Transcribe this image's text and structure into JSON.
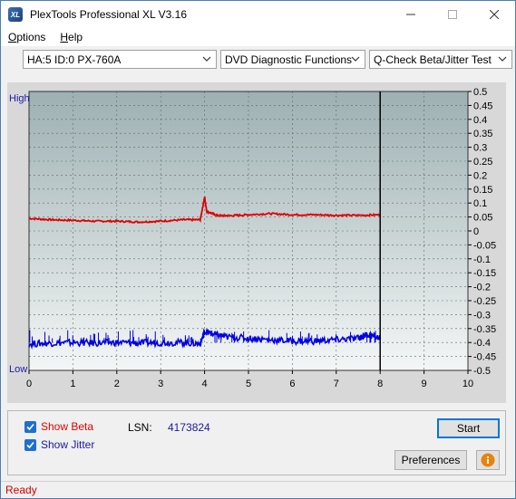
{
  "window": {
    "title": "PlexTools Professional XL V3.16",
    "icon_text": "XL"
  },
  "menu": [
    {
      "label": "Options",
      "mnemonic": "O",
      "rest": "ptions"
    },
    {
      "label": "Help",
      "mnemonic": "H",
      "rest": "elp"
    }
  ],
  "toolbar": {
    "drive": "HA:5 ID:0  PX-760A",
    "function": "DVD Diagnostic Functions",
    "test": "Q-Check Beta/Jitter Test"
  },
  "chart_data": {
    "type": "line",
    "left_axis": {
      "top_label": "High",
      "bottom_label": "Low"
    },
    "x": {
      "ticks": [
        0,
        1,
        2,
        3,
        4,
        5,
        6,
        7,
        8,
        9,
        10
      ],
      "range": [
        0,
        10
      ]
    },
    "y_right": {
      "range": [
        -0.5,
        0.5
      ],
      "ticks": [
        "0.5",
        "0.45",
        "0.4",
        "0.35",
        "0.3",
        "0.25",
        "0.2",
        "0.15",
        "0.1",
        "0.05",
        "0",
        "-0.05",
        "-0.1",
        "-0.15",
        "-0.2",
        "-0.25",
        "-0.3",
        "-0.35",
        "-0.4",
        "-0.45",
        "-0.5"
      ]
    },
    "end_marker_x": 8.0,
    "series": [
      {
        "color": "#e00000",
        "points": [
          [
            0,
            0.045
          ],
          [
            0.5,
            0.04
          ],
          [
            1,
            0.038
          ],
          [
            1.5,
            0.035
          ],
          [
            2,
            0.035
          ],
          [
            2.5,
            0.032
          ],
          [
            3,
            0.035
          ],
          [
            3.5,
            0.04
          ],
          [
            3.9,
            0.04
          ],
          [
            4.0,
            0.12
          ],
          [
            4.05,
            0.07
          ],
          [
            4.3,
            0.055
          ],
          [
            4.6,
            0.055
          ],
          [
            5,
            0.058
          ],
          [
            5.5,
            0.062
          ],
          [
            6,
            0.058
          ],
          [
            6.5,
            0.058
          ],
          [
            7,
            0.056
          ],
          [
            7.5,
            0.056
          ],
          [
            8,
            0.058
          ]
        ]
      },
      {
        "color": "#0000e0",
        "points": [
          [
            0,
            -0.405
          ],
          [
            0.5,
            -0.402
          ],
          [
            1,
            -0.4
          ],
          [
            1.5,
            -0.402
          ],
          [
            2,
            -0.4
          ],
          [
            2.5,
            -0.402
          ],
          [
            3,
            -0.4
          ],
          [
            3.5,
            -0.4
          ],
          [
            3.9,
            -0.405
          ],
          [
            4.0,
            -0.36
          ],
          [
            4.2,
            -0.37
          ],
          [
            4.5,
            -0.38
          ],
          [
            5,
            -0.385
          ],
          [
            5.5,
            -0.39
          ],
          [
            6,
            -0.395
          ],
          [
            6.5,
            -0.395
          ],
          [
            7,
            -0.39
          ],
          [
            7.5,
            -0.385
          ],
          [
            7.7,
            -0.37
          ],
          [
            8,
            -0.385
          ]
        ]
      }
    ]
  },
  "controls": {
    "show_beta": "Show Beta",
    "show_beta_mnemonic": "B",
    "show_jitter": "Show Jitter",
    "show_jitter_mnemonic": "J",
    "lsn_label": "LSN:",
    "lsn_value": "4173824",
    "start_label": "Start",
    "preferences_label": "Preferences"
  },
  "status": {
    "text": "Ready"
  },
  "colors": {
    "beta": "#e00000",
    "jitter": "#0000e0",
    "status": "#d00000",
    "link_blue": "#1a1aa6"
  }
}
